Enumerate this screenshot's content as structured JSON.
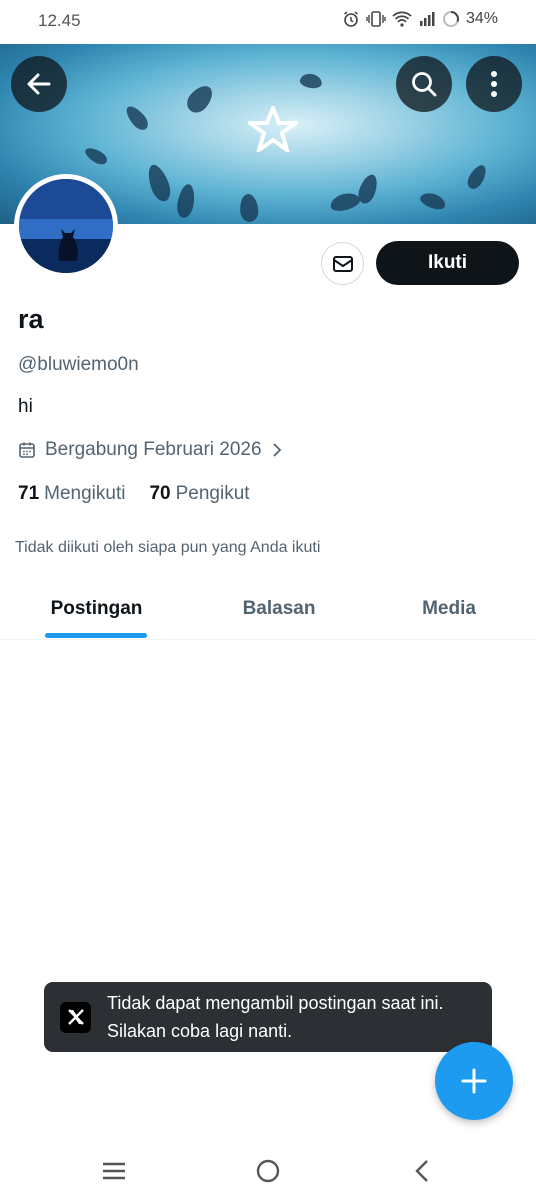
{
  "status_bar": {
    "time": "12.45",
    "battery": "34%",
    "icons": [
      "alarm-icon",
      "vibrate-icon",
      "wifi-icon",
      "signal-icon",
      "battery-icon"
    ]
  },
  "header": {
    "back_icon": "arrow-left-icon",
    "search_icon": "search-icon",
    "more_icon": "more-vertical-icon"
  },
  "profile": {
    "name": "ra",
    "handle": "@bluwiemo0n",
    "bio": "hi",
    "joined": "Bergabung Februari 2026",
    "following_count": "71",
    "following_label": "Mengikuti",
    "followers_count": "70",
    "followers_label": "Pengikut",
    "not_followed_note": "Tidak diikuti oleh siapa pun yang Anda ikuti",
    "follow_button": "Ikuti",
    "message_icon": "mail-icon"
  },
  "tabs": [
    {
      "label": "Postingan",
      "active": true
    },
    {
      "label": "Balasan",
      "active": false
    },
    {
      "label": "Media",
      "active": false
    }
  ],
  "toast": {
    "message": "Tidak dapat mengambil postingan saat ini. Silakan coba lagi nanti.",
    "icon": "x-logo-icon"
  },
  "fab": {
    "icon": "plus-icon"
  },
  "system_nav": {
    "recents_icon": "recents-icon",
    "home_icon": "home-icon",
    "back_icon": "back-chevron-icon"
  },
  "colors": {
    "accent": "#1d9bf0",
    "text_primary": "#0f1419",
    "text_secondary": "#536471",
    "follow_bg": "#0f1419",
    "toast_bg": "#2c2f33"
  }
}
